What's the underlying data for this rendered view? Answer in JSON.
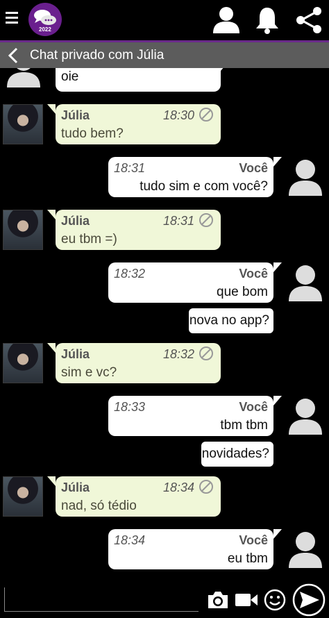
{
  "app": {
    "logo_badge": "2022",
    "accent": "#6a2a8a"
  },
  "header": {
    "title": "Chat privado com Júlia"
  },
  "icons": {
    "menu": "menu-icon",
    "profile": "person-icon",
    "notifications": "bell-icon",
    "share": "share-icon",
    "back": "chevron-left-icon",
    "camera": "camera-icon",
    "video": "video-icon",
    "emoji": "smiley-icon",
    "send": "send-icon"
  },
  "messages": [
    {
      "from": "Você",
      "text": "oie"
    },
    {
      "from": "Júlia",
      "time": "18:30",
      "text": "tudo bem?"
    },
    {
      "from": "Você",
      "time": "18:31",
      "text": "tudo sim e com você?"
    },
    {
      "from": "Júlia",
      "time": "18:31",
      "text": "eu tbm =)"
    },
    {
      "from": "Você",
      "time": "18:32",
      "text": "que bom"
    },
    {
      "from": "Você",
      "text": "nova no app?"
    },
    {
      "from": "Júlia",
      "time": "18:32",
      "text": "sim e vc?"
    },
    {
      "from": "Você",
      "time": "18:33",
      "text": "tbm tbm"
    },
    {
      "from": "Você",
      "text": "novidades?"
    },
    {
      "from": "Júlia",
      "time": "18:34",
      "text": "nad, só tédio"
    },
    {
      "from": "Você",
      "time": "18:34",
      "text": "eu tbm"
    }
  ],
  "composer": {
    "value": "",
    "placeholder": ""
  }
}
